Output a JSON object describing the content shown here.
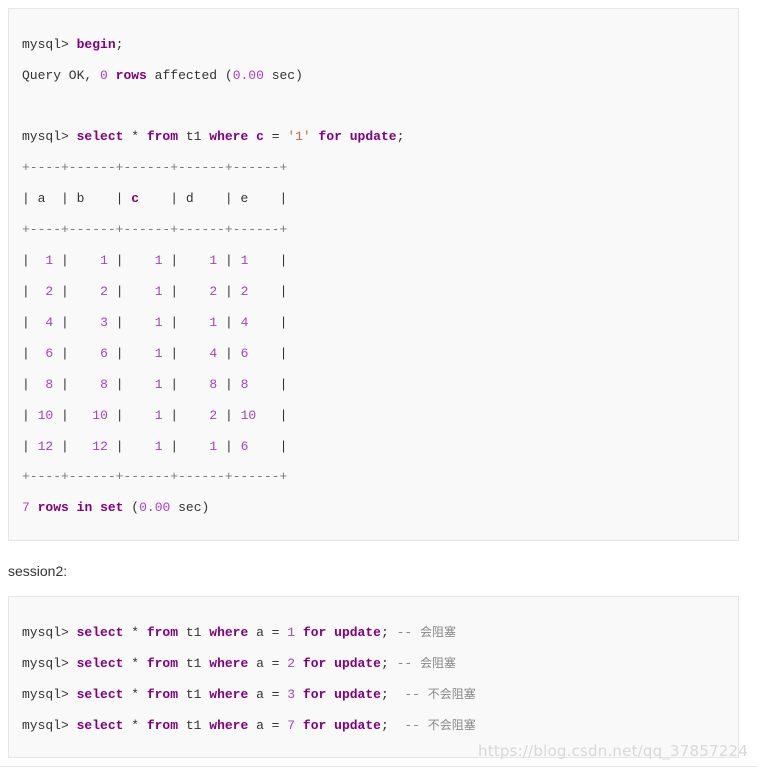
{
  "box1": {
    "begin": {
      "prompt": "mysql> ",
      "kw": "begin",
      "end": ";"
    },
    "query_ok": {
      "text": "Query OK, ",
      "num": "0",
      "kw": "rows",
      "mid": " affected (",
      "time": "0.00",
      "tail": " sec)"
    },
    "select": {
      "prompt": "mysql> ",
      "kw_select": "select",
      "star": " * ",
      "kw_from": "from",
      "table": " t1 ",
      "kw_where": "where",
      "space": " ",
      "col": "c",
      "eq": " = ",
      "val": "'1'",
      "sp2": " ",
      "kw_for": "for",
      "sp3": " ",
      "kw_update": "update",
      "semi": ";"
    },
    "border": "+----+------+------+------+------+",
    "header": {
      "pre": "| a  | b    | ",
      "col_c": "c",
      "post": "    | d    | e    |"
    },
    "rows": [
      [
        "1",
        "1",
        "1",
        "1",
        "1"
      ],
      [
        "2",
        "2",
        "1",
        "2",
        "2"
      ],
      [
        "4",
        "3",
        "1",
        "1",
        "4"
      ],
      [
        "6",
        "6",
        "1",
        "4",
        "6"
      ],
      [
        "8",
        "8",
        "1",
        "8",
        "8"
      ],
      [
        "10",
        "10",
        "1",
        "2",
        "10"
      ],
      [
        "12",
        "12",
        "1",
        "1",
        "6"
      ]
    ],
    "footer": {
      "count": "7",
      "sp": " ",
      "kw_rows": "rows",
      "kw_in": "in",
      "kw_set": "set",
      "mid": " (",
      "time": "0.00",
      "tail": " sec)"
    }
  },
  "session2_label": "session2:",
  "box2": {
    "lines": [
      {
        "prompt": "mysql> ",
        "kw_select": "select",
        "star": " * ",
        "kw_from": "from",
        "table": " t1 ",
        "kw_where": "where",
        "cond": " a = ",
        "val": "1",
        "kw_for": "for",
        "kw_update": "update",
        "semi": "; ",
        "dash": "-- ",
        "comment": "会阻塞"
      },
      {
        "prompt": "mysql> ",
        "kw_select": "select",
        "star": " * ",
        "kw_from": "from",
        "table": " t1 ",
        "kw_where": "where",
        "cond": " a = ",
        "val": "2",
        "kw_for": "for",
        "kw_update": "update",
        "semi": "; ",
        "dash": "-- ",
        "comment": "会阻塞"
      },
      {
        "prompt": "mysql> ",
        "kw_select": "select",
        "star": " * ",
        "kw_from": "from",
        "table": " t1 ",
        "kw_where": "where",
        "cond": " a = ",
        "val": "3",
        "kw_for": "for",
        "kw_update": "update",
        "semi": ";  ",
        "dash": "-- ",
        "comment": "不会阻塞"
      },
      {
        "prompt": "mysql> ",
        "kw_select": "select",
        "star": " * ",
        "kw_from": "from",
        "table": " t1 ",
        "kw_where": "where",
        "cond": " a = ",
        "val": "7",
        "kw_for": "for",
        "kw_update": "update",
        "semi": ";  ",
        "dash": "-- ",
        "comment": "不会阻塞"
      }
    ]
  },
  "watermark": "https://blog.csdn.net/qq_37857224"
}
